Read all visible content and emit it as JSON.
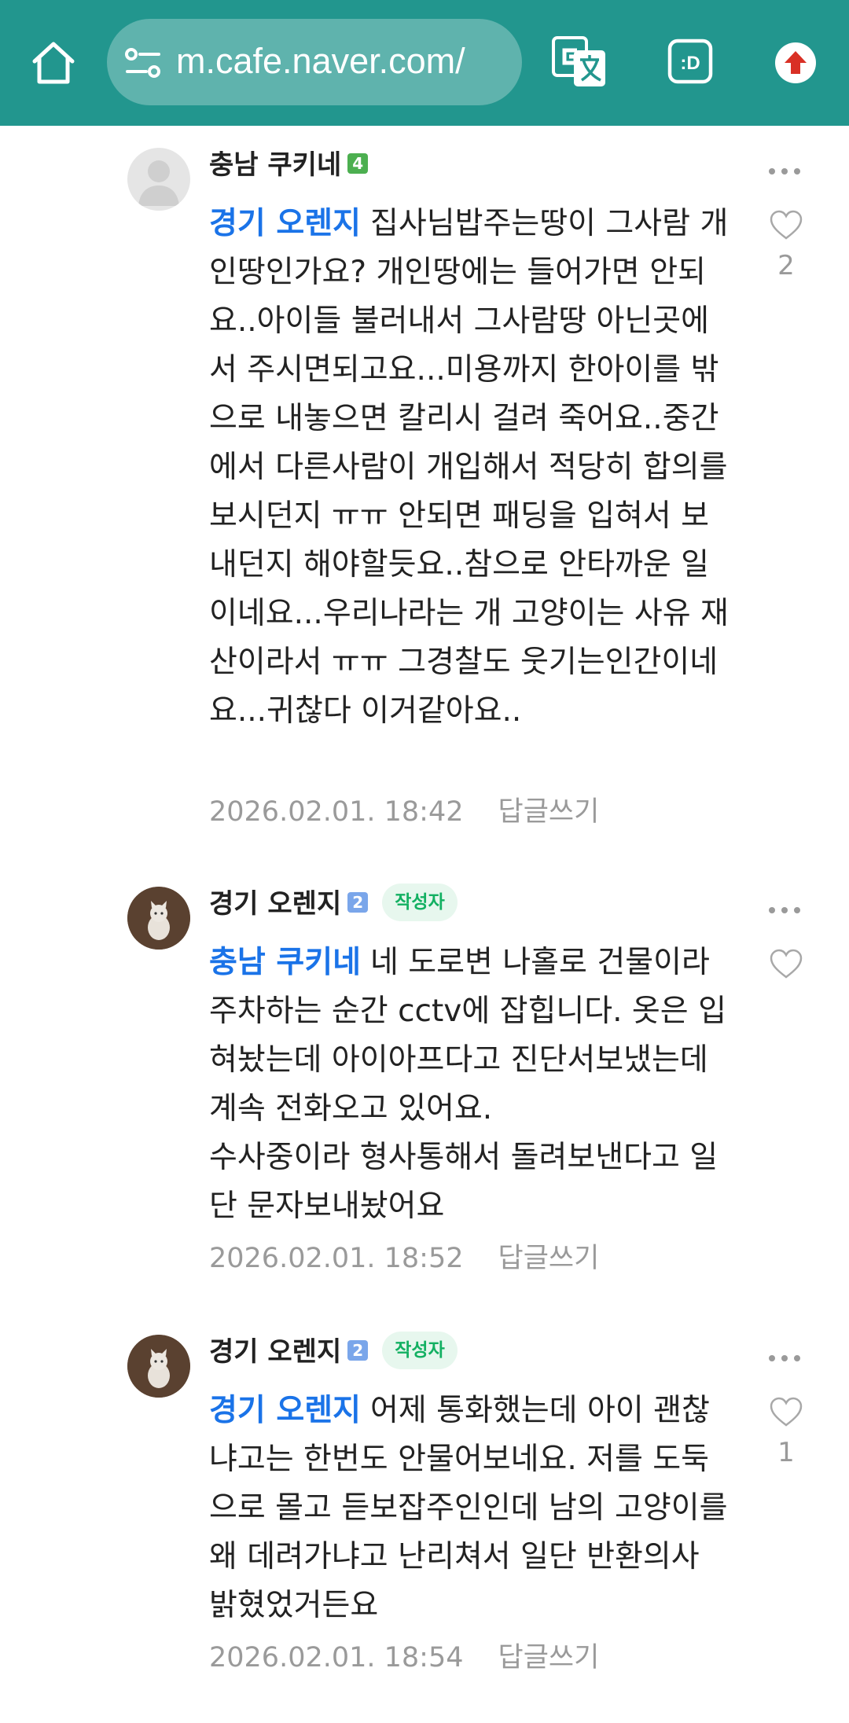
{
  "browser": {
    "url": "m.cafe.naver.com/",
    "toolbar_color": "#22968e"
  },
  "comments": [
    {
      "author": "충남 쿠키네",
      "level": "4",
      "level_color": "#4caf50",
      "is_writer": false,
      "avatar": "default-avatar",
      "mention": "경기 오렌지",
      "text": "집사님밥주는땅이 그사람 개인땅인가요? 개인땅에는 들어가면 안되요..아이들 불러내서 그사람땅 아닌곳에서 주시면되고요...미용까지 한아이를 밖으로 내놓으면 칼리시 걸려 죽어요..중간에서 다른사람이 개입해서 적당히 합의를 보시던지 ㅠㅠ 안되면 패딩을 입혀서 보내던지 해야할듯요..참으로 안타까운 일이네요...우리나라는 개 고양이는 사유 재산이라서 ㅠㅠ 그경찰도 웃기는인간이네요...귀찮다 이거같아요..",
      "date": "2026.02.01. 18:42",
      "reply": "답글쓰기",
      "likes": "2"
    },
    {
      "author": "경기 오렌지",
      "level": "2",
      "level_color": "#7aa6ea",
      "is_writer": true,
      "writer_badge": "작성자",
      "avatar": "cat-avatar",
      "mention": "충남 쿠키네",
      "text": "네 도로변 나홀로 건물이라 주차하는 순간 cctv에 잡힙니다. 옷은 입혀놨는데 아이아프다고 진단서보냈는데 계속 전화오고 있어요.\n수사중이라 형사통해서 돌려보낸다고 일단 문자보내놨어요",
      "date": "2026.02.01. 18:52",
      "reply": "답글쓰기",
      "likes": ""
    },
    {
      "author": "경기 오렌지",
      "level": "2",
      "level_color": "#7aa6ea",
      "is_writer": true,
      "writer_badge": "작성자",
      "avatar": "cat-avatar",
      "mention": "경기 오렌지",
      "text": "어제 통화했는데 아이 괜찮냐고는 한번도 안물어보네요. 저를 도둑으로 몰고 듣보잡주인인데 남의 고양이를 왜 데려가냐고 난리쳐서 일단 반환의사 밝혔었거든요",
      "date": "2026.02.01. 18:54",
      "reply": "답글쓰기",
      "likes": "1"
    }
  ]
}
